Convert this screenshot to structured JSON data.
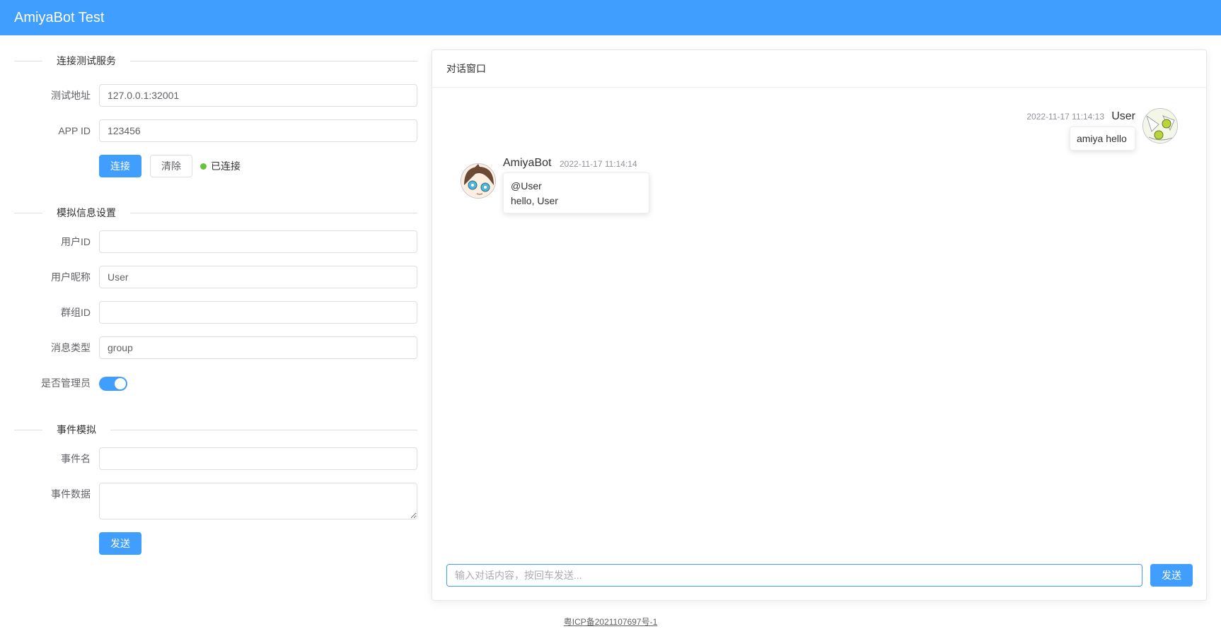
{
  "app": {
    "title": "AmiyaBot Test"
  },
  "connection": {
    "section_title": "连接测试服务",
    "address_label": "测试地址",
    "address_value": "127.0.0.1:32001",
    "appid_label": "APP ID",
    "appid_value": "123456",
    "connect_button": "连接",
    "clear_button": "清除",
    "status_text": "已连接",
    "status_color": "#67c23a"
  },
  "simulation": {
    "section_title": "模拟信息设置",
    "user_id_label": "用户ID",
    "user_id_value": "",
    "nickname_label": "用户昵称",
    "nickname_value": "User",
    "group_id_label": "群组ID",
    "group_id_value": "",
    "msg_type_label": "消息类型",
    "msg_type_value": "group",
    "admin_label": "是否管理员",
    "admin_enabled": true
  },
  "event": {
    "section_title": "事件模拟",
    "name_label": "事件名",
    "name_value": "",
    "data_label": "事件数据",
    "data_value": "",
    "send_button": "发送"
  },
  "chat": {
    "title": "对话窗口",
    "messages": [
      {
        "side": "right",
        "name": "User",
        "time": "2022-11-17 11:14:13",
        "lines": [
          "amiya hello"
        ]
      },
      {
        "side": "left",
        "name": "AmiyaBot",
        "time": "2022-11-17 11:14:14",
        "lines": [
          "@User",
          "hello, User"
        ]
      }
    ],
    "input_placeholder": "输入对话内容，按回车发送...",
    "send_button": "发送"
  },
  "footer": {
    "icp": "粤ICP备2021107697号-1"
  },
  "colors": {
    "primary": "#409eff",
    "success": "#67c23a"
  }
}
